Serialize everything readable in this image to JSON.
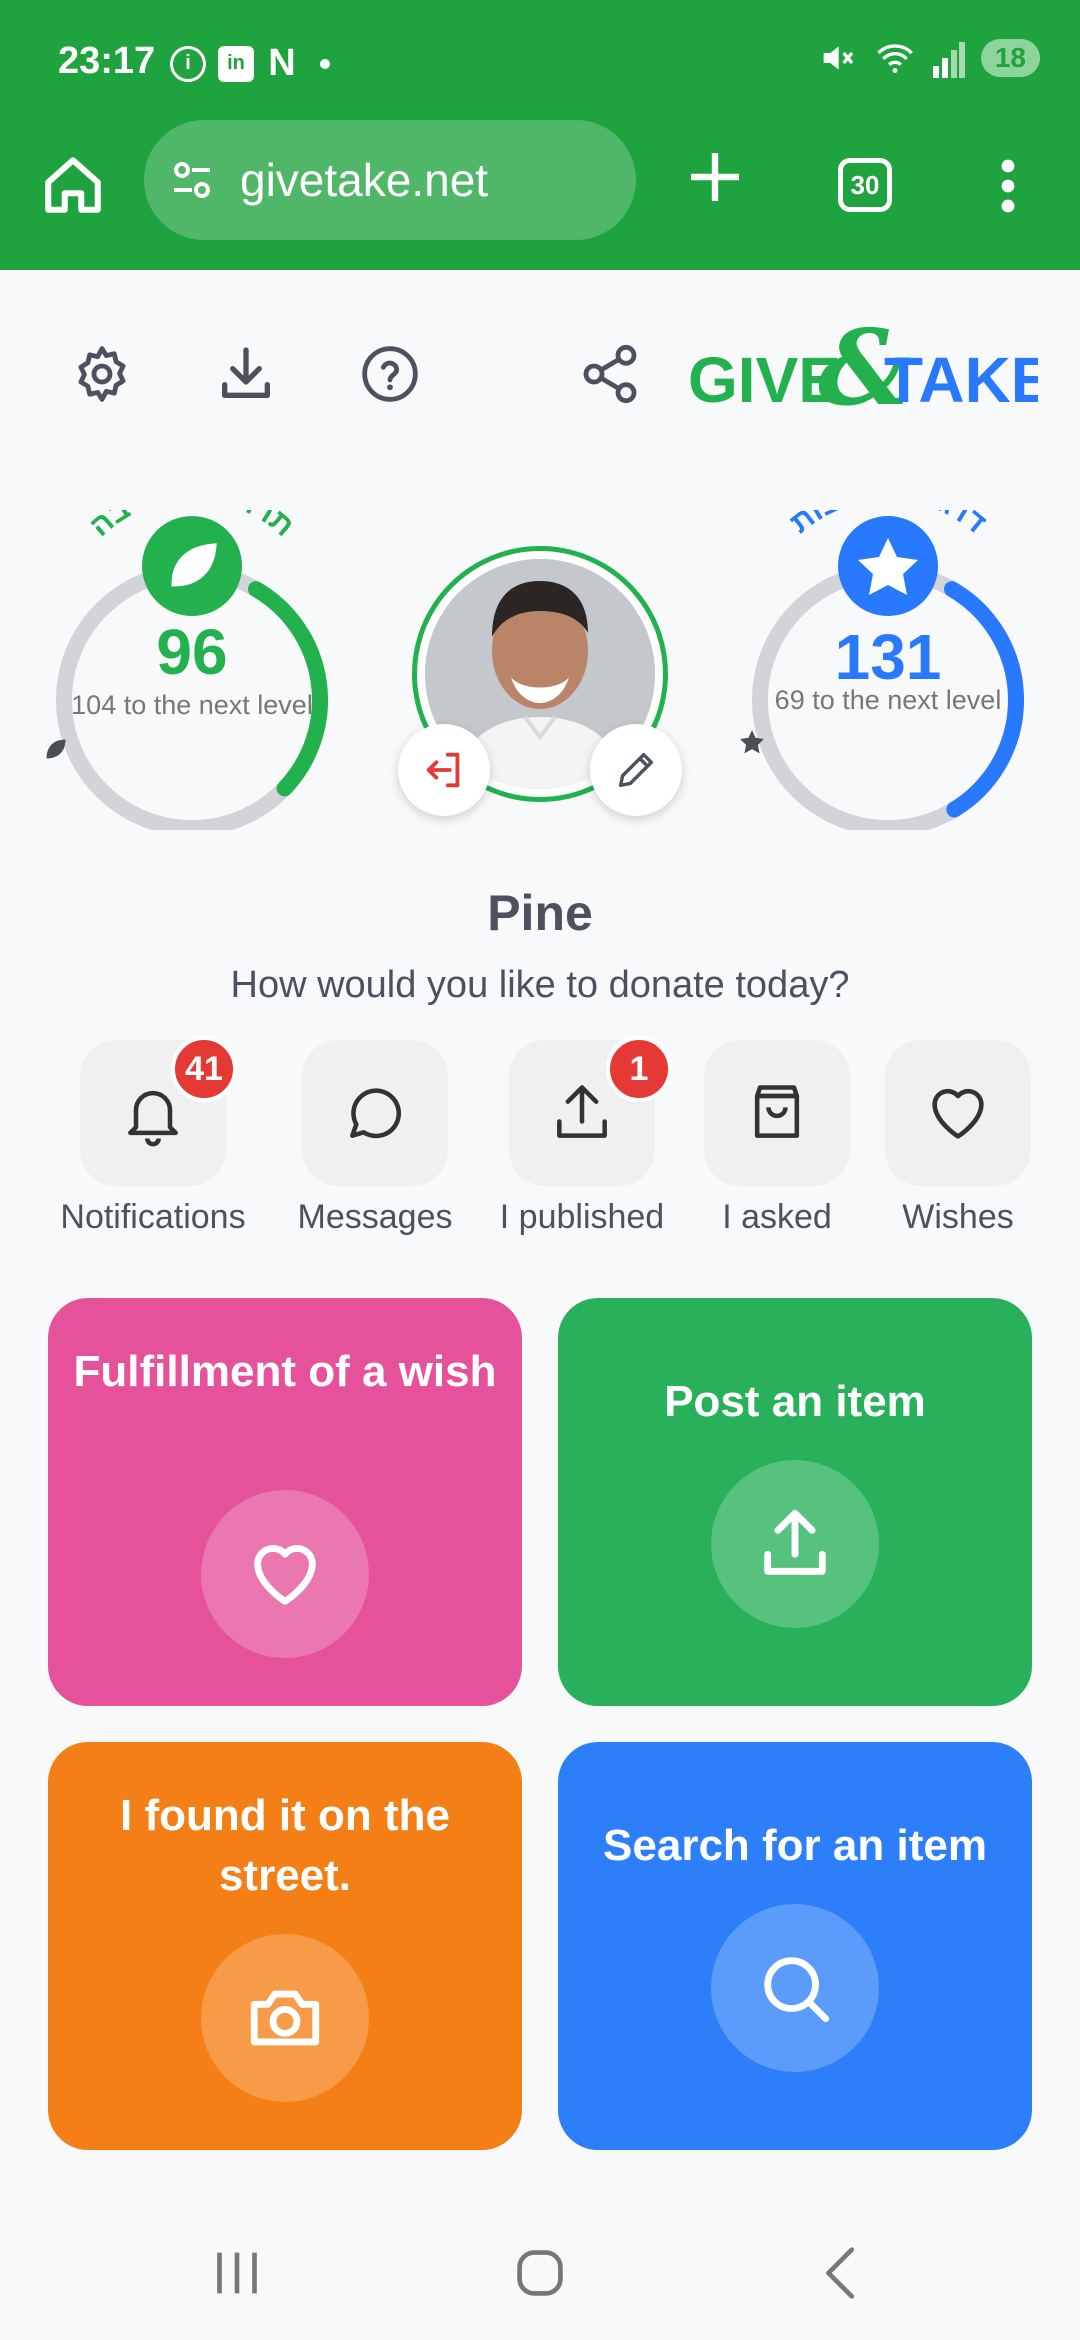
{
  "status_bar": {
    "time": "23:17",
    "battery": "18",
    "icons": [
      "info-icon",
      "linkedin-icon",
      "n-icon",
      "mute-icon",
      "wifi-icon",
      "signal-icon"
    ]
  },
  "browser": {
    "url": "givetake.net",
    "tab_count": "30"
  },
  "header": {
    "logo_text_left": "GIVE",
    "logo_text_right": "TAKE",
    "logo_ampersand": "&",
    "brand_colors": {
      "green": "#22b14c",
      "blue": "#2979ff"
    }
  },
  "gauge_donation": {
    "title": "תרומה לסביבה",
    "value": "96",
    "subtitle": "104 to the next level",
    "progress": 0.48,
    "color": "#22b14c",
    "marks_filled": 2,
    "marks_total": 5
  },
  "gauge_engagement": {
    "title": "דרגת מעורבות",
    "value": "131",
    "subtitle": "69 to the next level",
    "progress": 0.66,
    "color": "#2979ff",
    "marks_filled": 2,
    "marks_total": 5
  },
  "profile": {
    "name": "Pine",
    "prompt": "How would you like to donate today?"
  },
  "quick_actions": [
    {
      "label": "Notifications",
      "badge": "41",
      "icon": "bell-icon"
    },
    {
      "label": "Messages",
      "badge": "",
      "icon": "chat-icon"
    },
    {
      "label": "I published",
      "badge": "1",
      "icon": "upload-icon"
    },
    {
      "label": "I asked",
      "badge": "",
      "icon": "bag-icon"
    },
    {
      "label": "Wishes",
      "badge": "",
      "icon": "heart-icon"
    }
  ],
  "cards": [
    {
      "label": "Fulfillment of a wish",
      "color": "#e5519a",
      "icon": "heart-icon"
    },
    {
      "label": "Post an item",
      "color": "#28b05a",
      "icon": "upload-icon"
    },
    {
      "label": "I found it on the street.",
      "color": "#f57f17",
      "icon": "camera-icon"
    },
    {
      "label": "Search for an item",
      "color": "#2d7ff9",
      "icon": "search-icon"
    }
  ]
}
